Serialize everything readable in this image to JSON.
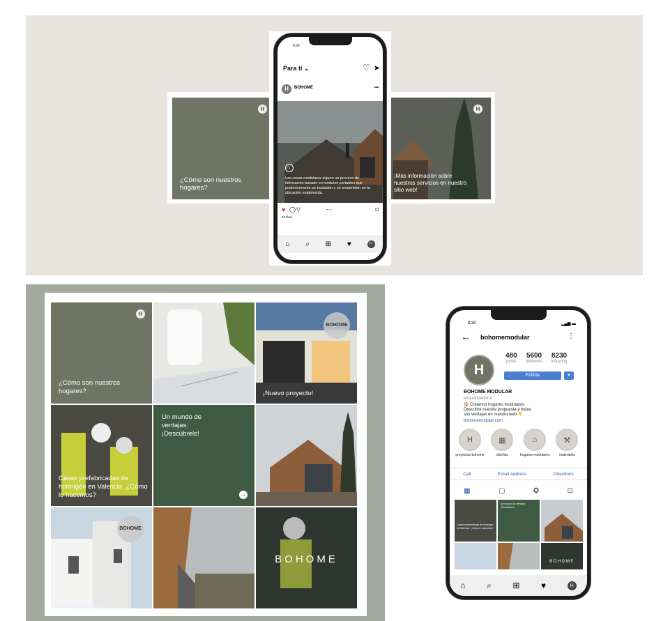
{
  "top": {
    "status_time": "8:36",
    "header_label": "Para ti",
    "account": "BOHOME",
    "more": "•••",
    "slide_left_text": "¿Cómo son nuestros hogares?",
    "slide_center_text": "Las casas modulares siguen un proceso de fabricación basado en módulos portables que posteriormente se trasladan y se ensamblan en la ubicación establecida.",
    "slide_right_text": "¡Más información sobre nuestros servicios en nuestro sitio web!",
    "likes": "46 likes",
    "logo_letter": "H"
  },
  "grid": {
    "tile1": "¿Cómo son nuestros hogares?",
    "tile3_badge": "BOHOME",
    "tile3": "¡Nuevo proyecto!",
    "tile4": "Casas prefabricadas de hormigón en Valencia. ¿Cómo lo hacemos?",
    "tile5": "Un mundo de ventajas. ¡Descúbrelo!",
    "tile7_badge": "BOHOME",
    "tile7": "¡Nuevo proyecto!",
    "tile9": "BOHOME"
  },
  "profile": {
    "status_time": "8:30",
    "username": "bohomemodular",
    "posts_num": "480",
    "posts_label": "posts",
    "followers_num": "5600",
    "followers_label": "followers",
    "following_num": "8230",
    "following_label": "following",
    "follow_label": "Follow",
    "name": "BOHOME MODULAR",
    "category": "emprendedor/a",
    "bio1": "🏠 Creamos hogares modulares.",
    "bio2": "Descubre nuestra propuesta y todas",
    "bio3": "sus ventajas en nuestra web 👇",
    "link": "bohomemodular.com",
    "highlights": [
      "proyectos bohome",
      "diseños",
      "hogares modulares",
      "materiales"
    ],
    "call": "Call",
    "email": "Email Address",
    "directions": "Directions",
    "mini_tile5": "Un mundo de ventajas. ¡Descúbrelo!",
    "mini_tile4": "Casas prefabricadas de hormigón en Valencia. ¿Cómo lo hacemos?",
    "mini_tile9": "BOHOME"
  },
  "colors": {
    "top_bg": "#e7e4df",
    "grid_bg": "#a3a89e",
    "olive": "#6f7464",
    "green": "#3f5b43",
    "follow_blue": "#4a7fd0"
  }
}
